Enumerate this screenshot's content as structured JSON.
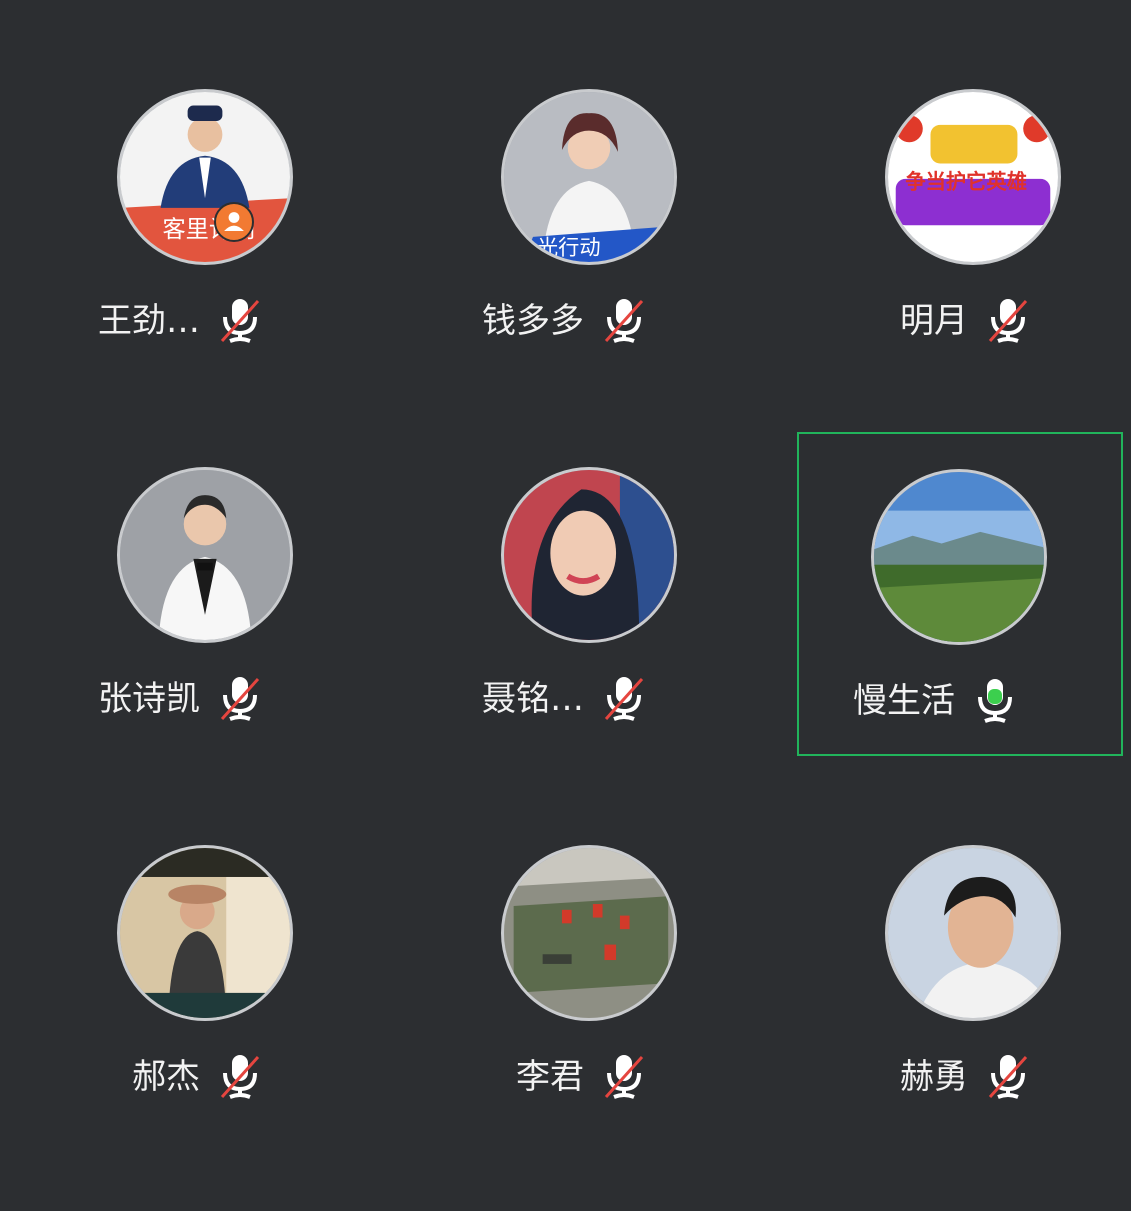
{
  "colors": {
    "background": "#2c2e31",
    "speaking_border": "#21b45b",
    "muted_slash": "#e5453f",
    "active_mic": "#3ccf4e",
    "host_badge": "#f27a32"
  },
  "participants": [
    {
      "name": "王劲…",
      "muted": true,
      "host": true,
      "avatar_icon": "person-photo-icon",
      "avatar_text": "客里计划"
    },
    {
      "name": "钱多多",
      "muted": true,
      "host": false,
      "avatar_icon": "person-photo-icon",
      "avatar_text": "光行动"
    },
    {
      "name": "明月",
      "muted": true,
      "host": false,
      "avatar_icon": "poster-text-icon",
      "avatar_text": "争当护它英雄"
    },
    {
      "name": "张诗凯",
      "muted": true,
      "host": false,
      "avatar_icon": "person-photo-icon"
    },
    {
      "name": "聂铭…",
      "muted": true,
      "host": false,
      "avatar_icon": "person-photo-icon"
    },
    {
      "name": "慢生活",
      "muted": false,
      "speaking": true,
      "host": false,
      "avatar_icon": "landscape-photo-icon"
    },
    {
      "name": "郝杰",
      "muted": true,
      "host": false,
      "avatar_icon": "person-photo-icon"
    },
    {
      "name": "李君",
      "muted": true,
      "host": false,
      "avatar_icon": "crowd-photo-icon"
    },
    {
      "name": "赫勇",
      "muted": true,
      "host": false,
      "avatar_icon": "person-photo-icon"
    }
  ]
}
